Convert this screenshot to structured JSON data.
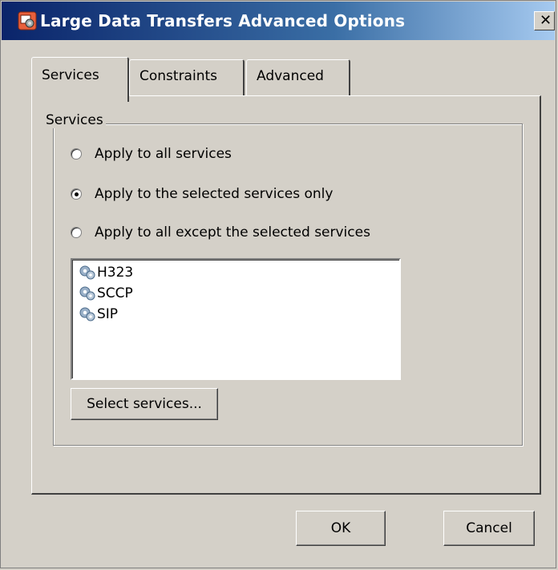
{
  "window": {
    "title": "Large Data Transfers Advanced Options",
    "close_glyph": "✕"
  },
  "tabs": [
    {
      "label": "Services",
      "active": true
    },
    {
      "label": "Constraints",
      "active": false
    },
    {
      "label": "Advanced",
      "active": false
    }
  ],
  "services_group": {
    "legend": "Services",
    "options": [
      {
        "label": "Apply to all services",
        "selected": false
      },
      {
        "label": "Apply to the selected services only",
        "selected": true
      },
      {
        "label": "Apply to all except the selected services",
        "selected": false
      }
    ],
    "list_items": [
      {
        "label": "H323",
        "icon": "services-gear-icon"
      },
      {
        "label": "SCCP",
        "icon": "services-gear-icon"
      },
      {
        "label": "SIP",
        "icon": "services-gear-icon"
      }
    ],
    "select_button_label": "Select services..."
  },
  "footer": {
    "ok_label": "OK",
    "cancel_label": "Cancel"
  },
  "colors": {
    "dialog_bg": "#d4d0c8",
    "titlebar_start": "#0a246a",
    "titlebar_end": "#a6caf0"
  }
}
